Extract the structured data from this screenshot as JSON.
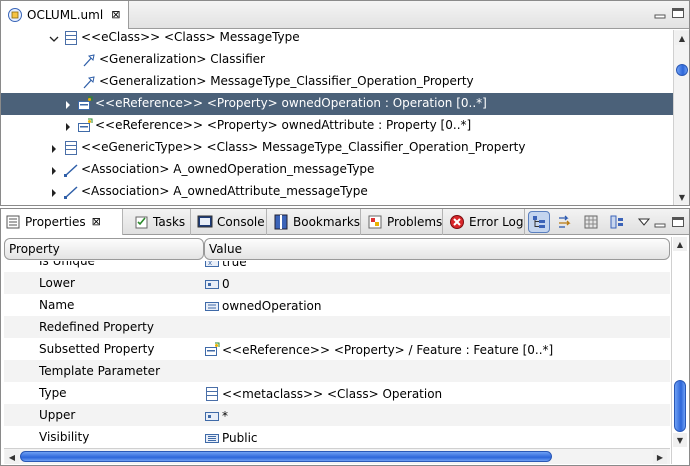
{
  "editor": {
    "tab_title": "OCLUML.uml",
    "close_glyph": "⊠"
  },
  "tree": {
    "rows": [
      {
        "label": "<<eClass>> <Class> MessageType",
        "icon": "class-icon",
        "expanded": true,
        "selected": false
      },
      {
        "label": "<Generalization> Classifier",
        "icon": "generalization-icon",
        "selected": false
      },
      {
        "label": "<Generalization> MessageType_Classifier_Operation_Property",
        "icon": "generalization-icon",
        "selected": false
      },
      {
        "label": "<<eReference>> <Property> ownedOperation : Operation [0..*]",
        "icon": "property-icon",
        "selected": true
      },
      {
        "label": "<<eReference>> <Property> ownedAttribute : Property [0..*]",
        "icon": "property-icon",
        "selected": false
      },
      {
        "label": "<<eGenericType>> <Class> MessageType_Classifier_Operation_Property",
        "icon": "class-icon",
        "selected": false
      },
      {
        "label": "<Association> A_ownedOperation_messageType",
        "icon": "association-icon",
        "selected": false
      },
      {
        "label": "<Association> A_ownedAttribute_messageType",
        "icon": "association-icon",
        "selected": false
      }
    ]
  },
  "views": {
    "tabs": [
      {
        "label": "Properties",
        "icon": "properties-icon",
        "active": true,
        "closable": true
      },
      {
        "label": "Tasks",
        "icon": "tasks-icon"
      },
      {
        "label": "Console",
        "icon": "console-icon"
      },
      {
        "label": "Bookmarks",
        "icon": "bookmarks-icon"
      },
      {
        "label": "Problems",
        "icon": "problems-icon"
      },
      {
        "label": "Error Log",
        "icon": "error-log-icon"
      }
    ]
  },
  "properties": {
    "col_property": "Property",
    "col_value": "Value",
    "rows": [
      {
        "name": "Is Unique",
        "value": "true",
        "icon": "boolean-icon"
      },
      {
        "name": "Lower",
        "value": "0",
        "icon": "integer-icon"
      },
      {
        "name": "Name",
        "value": "ownedOperation",
        "icon": "text-icon"
      },
      {
        "name": "Redefined Property",
        "value": "",
        "icon": ""
      },
      {
        "name": "Subsetted Property",
        "value": "<<eReference>> <Property> / Feature : Feature [0..*]",
        "icon": "property-icon"
      },
      {
        "name": "Template Parameter",
        "value": "",
        "icon": ""
      },
      {
        "name": "Type",
        "value": "<<metaclass>> <Class> Operation",
        "icon": "class-icon"
      },
      {
        "name": "Upper",
        "value": "*",
        "icon": "integer-icon"
      },
      {
        "name": "Visibility",
        "value": "Public",
        "icon": "enum-icon"
      }
    ]
  },
  "colors": {
    "selection": "#4b6179",
    "scroll_thumb": "#2d66d9"
  }
}
